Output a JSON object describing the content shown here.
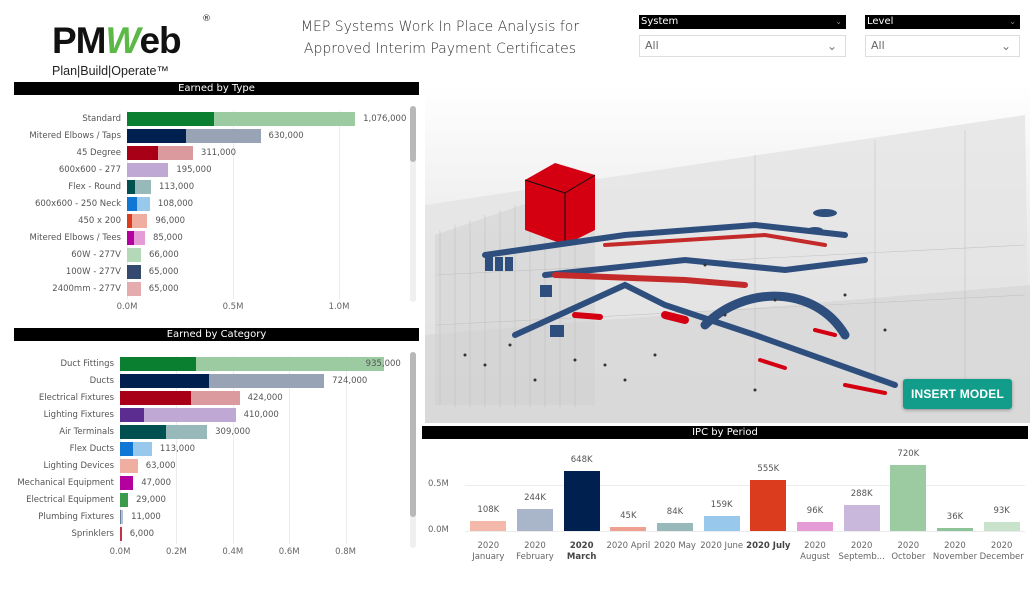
{
  "logo": {
    "word_left": "PM",
    "word_w": "W",
    "word_right": "eb",
    "registered": "®",
    "tagline": "Plan|Build|Operate™"
  },
  "title": {
    "line1": "MEP Systems Work In Place Analysis for",
    "line2": "Approved Interim Payment Certificates"
  },
  "slicers": [
    {
      "label": "System",
      "value": "All",
      "chevron": "chevron-down-icon"
    },
    {
      "label": "Level",
      "value": "All",
      "chevron": "chevron-down-icon"
    }
  ],
  "insert_model_label": "INSERT MODEL",
  "chart_data": [
    {
      "type": "bar",
      "orientation": "horizontal",
      "title": "Earned by Type",
      "categories": [
        "Standard",
        "Mitered Elbows / Taps",
        "45 Degree",
        "600x600 - 277",
        "Flex - Round",
        "600x600 - 250 Neck",
        "450 x 200",
        "Mitered Elbows / Tees",
        "60W - 277V",
        "100W - 277V",
        "2400mm - 277V"
      ],
      "values": [
        1076000,
        630000,
        311000,
        195000,
        113000,
        108000,
        96000,
        85000,
        66000,
        65000,
        65000
      ],
      "value_labels": [
        "1,076,000",
        "630,000",
        "311,000",
        "195,000",
        "113,000",
        "108,000",
        "96,000",
        "85,000",
        "66,000",
        "65,000",
        "65,000"
      ],
      "highlighted_values": [
        410000,
        280000,
        145000,
        0,
        40000,
        45000,
        25000,
        35000,
        0,
        65000,
        0
      ],
      "colors_dark": [
        "#0b7f30",
        "#002050",
        "#a80016",
        "#bfa8d3",
        "#005050",
        "#1078d4",
        "#db3c1e",
        "#b4009e",
        "#b3d9b8",
        "#334a6e",
        "#e4acae"
      ],
      "colors_light": [
        "#9ccba1",
        "#98a3b6",
        "#db9a9e",
        "#bfa8d3",
        "#98b9b9",
        "#99c8ed",
        "#f0aea0",
        "#e49bd6",
        "#b3d9b8",
        "#334a6e",
        "#e4acae"
      ],
      "xticks": [
        "0.0M",
        "0.5M",
        "1.0M"
      ],
      "xlim": [
        0,
        1200000
      ],
      "grid": true
    },
    {
      "type": "bar",
      "orientation": "horizontal",
      "title": "Earned by Category",
      "categories": [
        "Duct Fittings",
        "Ducts",
        "Electrical Fixtures",
        "Lighting Fixtures",
        "Air Terminals",
        "Flex Ducts",
        "Lighting Devices",
        "Mechanical Equipment",
        "Electrical Equipment",
        "Plumbing Fixtures",
        "Sprinklers"
      ],
      "values": [
        935000,
        724000,
        424000,
        410000,
        309000,
        113000,
        63000,
        47000,
        29000,
        11000,
        6000
      ],
      "value_labels": [
        "935,000",
        "724,000",
        "424,000",
        "410,000",
        "309,000",
        "113,000",
        "63,000",
        "47,000",
        "29,000",
        "11,000",
        "6,000"
      ],
      "highlighted_values": [
        268000,
        314000,
        250000,
        85000,
        162000,
        47000,
        0,
        47000,
        29000,
        5000,
        6000
      ],
      "colors_dark": [
        "#0b7f30",
        "#002050",
        "#a80016",
        "#5c2d91",
        "#005050",
        "#1078d4",
        "#f0aea0",
        "#b4009e",
        "#3c9a4c",
        "#6a7ea0",
        "#c4314b"
      ],
      "colors_light": [
        "#9ccba1",
        "#98a3b6",
        "#db9a9e",
        "#bfa8d3",
        "#98b9b9",
        "#99c8ed",
        "#f0aea0",
        "#b4009e",
        "#3c9a4c",
        "#b7c0d2",
        "#c4314b"
      ],
      "xticks": [
        "0.0M",
        "0.2M",
        "0.4M",
        "0.6M",
        "0.8M"
      ],
      "xlim": [
        0,
        1000000
      ],
      "grid": true
    },
    {
      "type": "bar",
      "orientation": "vertical",
      "title": "IPC by Period",
      "categories": [
        {
          "line1": "2020",
          "line2": "January",
          "bold": false
        },
        {
          "line1": "2020",
          "line2": "February",
          "bold": false
        },
        {
          "line1": "2020",
          "line2": "March",
          "bold": true
        },
        {
          "line1": "2020 April",
          "line2": "",
          "bold": false
        },
        {
          "line1": "2020 May",
          "line2": "",
          "bold": false
        },
        {
          "line1": "2020 June",
          "line2": "",
          "bold": false
        },
        {
          "line1": "2020 July",
          "line2": "",
          "bold": true
        },
        {
          "line1": "2020",
          "line2": "August",
          "bold": false
        },
        {
          "line1": "2020",
          "line2": "Septemb...",
          "bold": false
        },
        {
          "line1": "2020",
          "line2": "October",
          "bold": false
        },
        {
          "line1": "2020",
          "line2": "November",
          "bold": false
        },
        {
          "line1": "2020",
          "line2": "December",
          "bold": false
        }
      ],
      "values": [
        108000,
        244000,
        648000,
        45000,
        84000,
        159000,
        555000,
        96000,
        288000,
        720000,
        36000,
        93000
      ],
      "value_labels": [
        "108K",
        "244K",
        "648K",
        "45K",
        "84K",
        "159K",
        "555K",
        "96K",
        "288K",
        "720K",
        "36K",
        "93K"
      ],
      "colors": [
        "#f4b9aa",
        "#a9b5c8",
        "#002050",
        "#f0a090",
        "#98b9b9",
        "#99c8ed",
        "#db3c1e",
        "#e49bd6",
        "#c9b8dc",
        "#9ccba1",
        "#8fc49a",
        "#c8e2cb"
      ],
      "yticks": [
        "0.0M",
        "0.5M"
      ],
      "ylim": [
        0,
        800000
      ],
      "grid": true
    }
  ]
}
